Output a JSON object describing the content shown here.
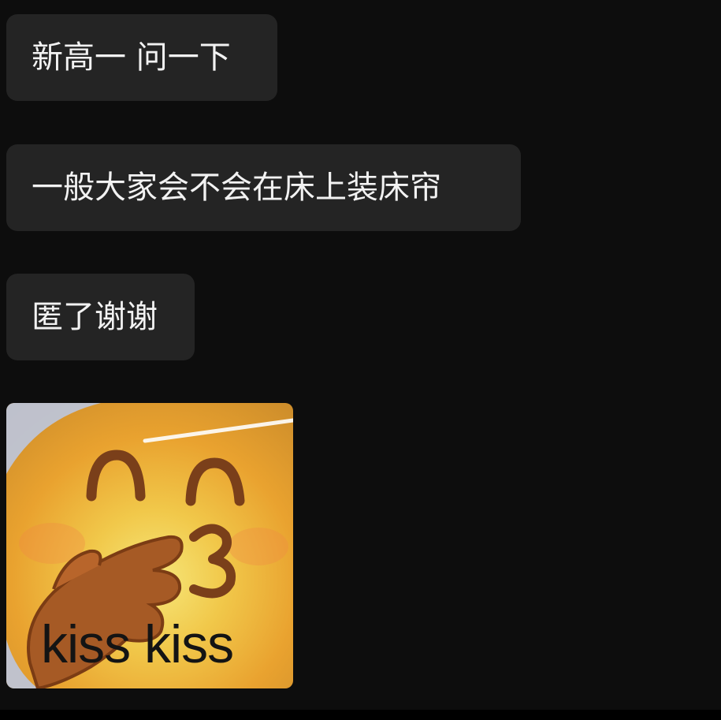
{
  "messages": [
    {
      "text": "新高一 问一下"
    },
    {
      "text": "一般大家会不会在床上装床帘"
    },
    {
      "text": "匿了谢谢"
    }
  ],
  "sticker": {
    "caption": "kiss kiss",
    "icon": "blowing-kiss-emoji"
  },
  "colors": {
    "background": "#0d0d0d",
    "bubble": "#242424",
    "text": "#f2f2f2"
  }
}
